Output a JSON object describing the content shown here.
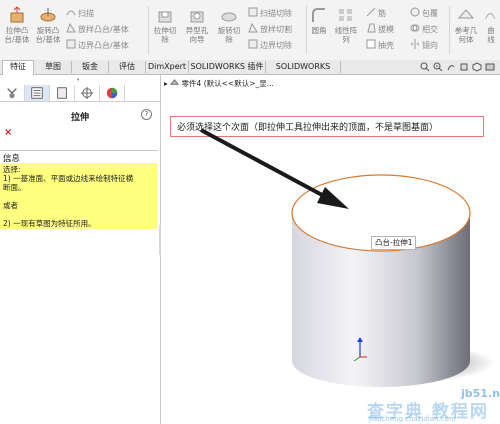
{
  "ribbon": {
    "extrude_boss": "拉伸凸\n台/基体",
    "revolve_boss": "旋转凸\n台/基体",
    "sweep": "扫描",
    "loft_boss": "放样凸台/基体",
    "boundary_boss": "边界凸台/基体",
    "extrude_cut": "拉伸切\n除",
    "hole_wizard": "异型孔\n向导",
    "revolve_cut": "旋转切\n除",
    "swept_cut": "扫描切除",
    "lofted_cut": "放样切割",
    "boundary_cut": "边界切除",
    "fillet": "圆角",
    "linear_pattern": "线性阵\n列",
    "rib": "筋",
    "draft": "拔模",
    "shell": "抽壳",
    "wrap": "包覆",
    "intersect": "相交",
    "mirror": "镜向",
    "reference_geometry": "参考几\n何体",
    "curves": "曲\n线"
  },
  "tabs": [
    "特征",
    "草图",
    "钣金",
    "评估",
    "DimXpert",
    "SOLIDWORKS 插件",
    "SOLIDWORKS MBD"
  ],
  "active_tab": "特征",
  "property_manager": {
    "title": "拉伸",
    "help": "?",
    "close": "×",
    "info_header": "信息",
    "info_lines": [
      "选择:",
      "1) 一基准面、平面或边线来绘制特征横",
      "断面。",
      "",
      "或者",
      "",
      "2) 一现有草图为特征所用。"
    ]
  },
  "viewport": {
    "breadcrumb": "零件4 (默认<<默认>_显...",
    "callout": "必须选择这个次面（即拉伸工具拉伸出来的顶面，不是草图基面）",
    "face_tag": "凸台-拉伸1"
  },
  "watermark": {
    "site": "jb51.net",
    "brand": "查字典 教程网",
    "url": "jiaocheng.chazidian.com"
  },
  "colors": {
    "callout_border": "#e07878",
    "info_bg": "#ffff80",
    "edge_highlight": "#d9782d",
    "arrow": "#1a1a1a"
  }
}
